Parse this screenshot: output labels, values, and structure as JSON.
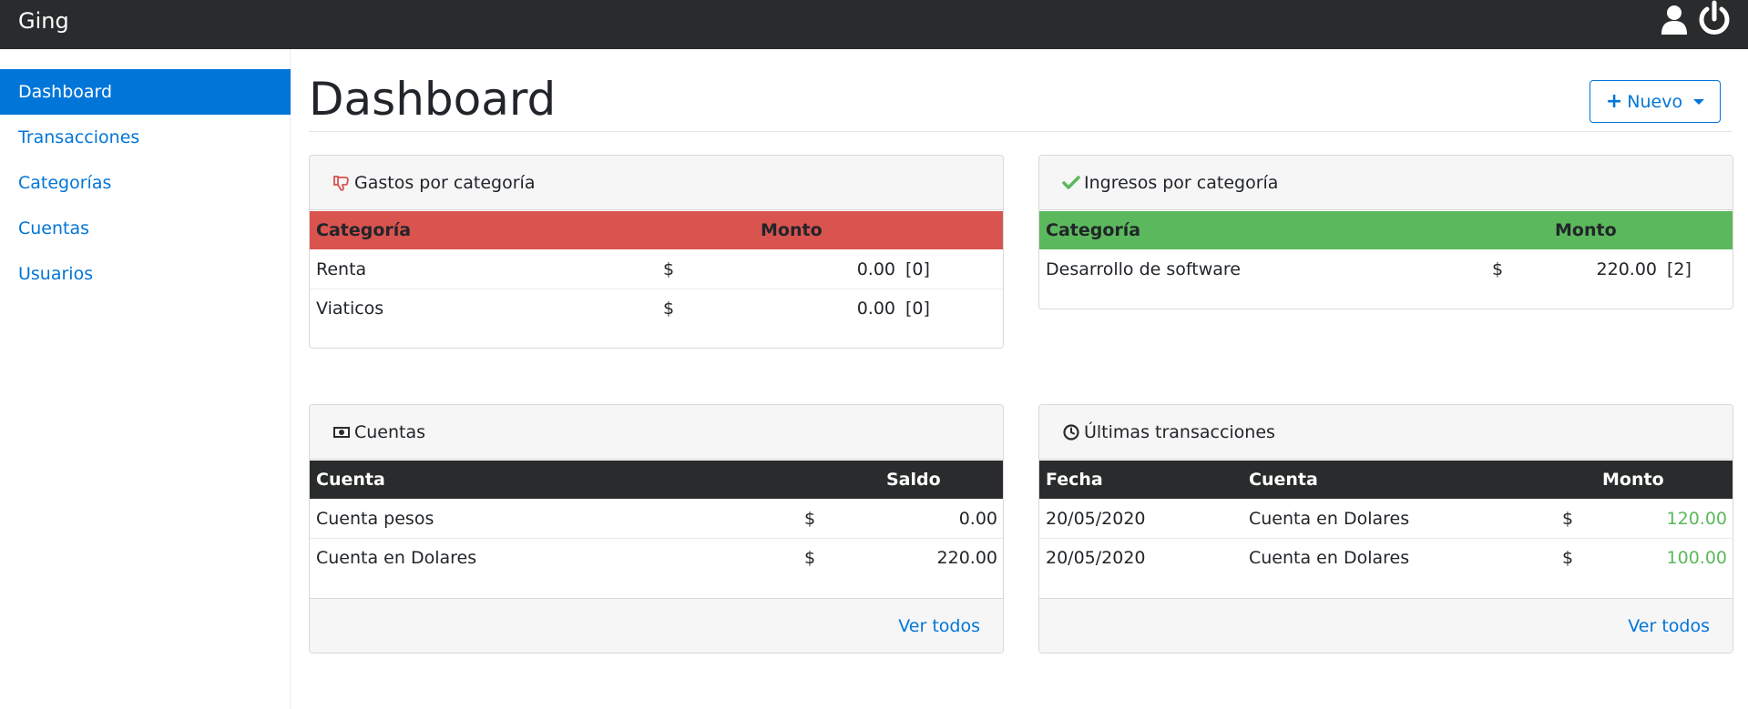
{
  "navbar": {
    "brand": "Ging",
    "icons": [
      "user-icon",
      "power-icon"
    ]
  },
  "sidebar": {
    "items": [
      {
        "label": "Dashboard",
        "active": true
      },
      {
        "label": "Transacciones"
      },
      {
        "label": "Categorías"
      },
      {
        "label": "Cuentas"
      },
      {
        "label": "Usuarios"
      }
    ]
  },
  "page": {
    "title": "Dashboard",
    "nuevo_label": "Nuevo",
    "nuevo_icon": "plus-icon"
  },
  "colors": {
    "primary": "#0275d8",
    "danger": "#d9534f",
    "success": "#5cb85c",
    "dark": "#292b2c"
  },
  "gastos": {
    "title": "Gastos por categoría",
    "icon": "thumbs-down-icon",
    "headers": [
      "Categoría",
      "Monto"
    ],
    "rows": [
      {
        "categoria": "Renta",
        "currency": "$",
        "monto": "0.00",
        "count": "[0]"
      },
      {
        "categoria": "Viaticos",
        "currency": "$",
        "monto": "0.00",
        "count": "[0]"
      }
    ]
  },
  "ingresos": {
    "title": "Ingresos por categoría",
    "icon": "check-icon",
    "headers": [
      "Categoría",
      "Monto"
    ],
    "rows": [
      {
        "categoria": "Desarrollo de software",
        "currency": "$",
        "monto": "220.00",
        "count": "[2]"
      }
    ]
  },
  "cuentas": {
    "title": "Cuentas",
    "icon": "money-icon",
    "headers": [
      "Cuenta",
      "Saldo"
    ],
    "rows": [
      {
        "cuenta": "Cuenta pesos",
        "currency": "$",
        "saldo": "0.00"
      },
      {
        "cuenta": "Cuenta en Dolares",
        "currency": "$",
        "saldo": "220.00"
      }
    ],
    "footer_link": "Ver todos"
  },
  "transacciones": {
    "title": "Últimas transacciones",
    "icon": "clock-icon",
    "headers": [
      "Fecha",
      "Cuenta",
      "Monto"
    ],
    "rows": [
      {
        "fecha": "20/05/2020",
        "cuenta": "Cuenta en Dolares",
        "currency": "$",
        "monto": "120.00"
      },
      {
        "fecha": "20/05/2020",
        "cuenta": "Cuenta en Dolares",
        "currency": "$",
        "monto": "100.00"
      }
    ],
    "footer_link": "Ver todos"
  }
}
